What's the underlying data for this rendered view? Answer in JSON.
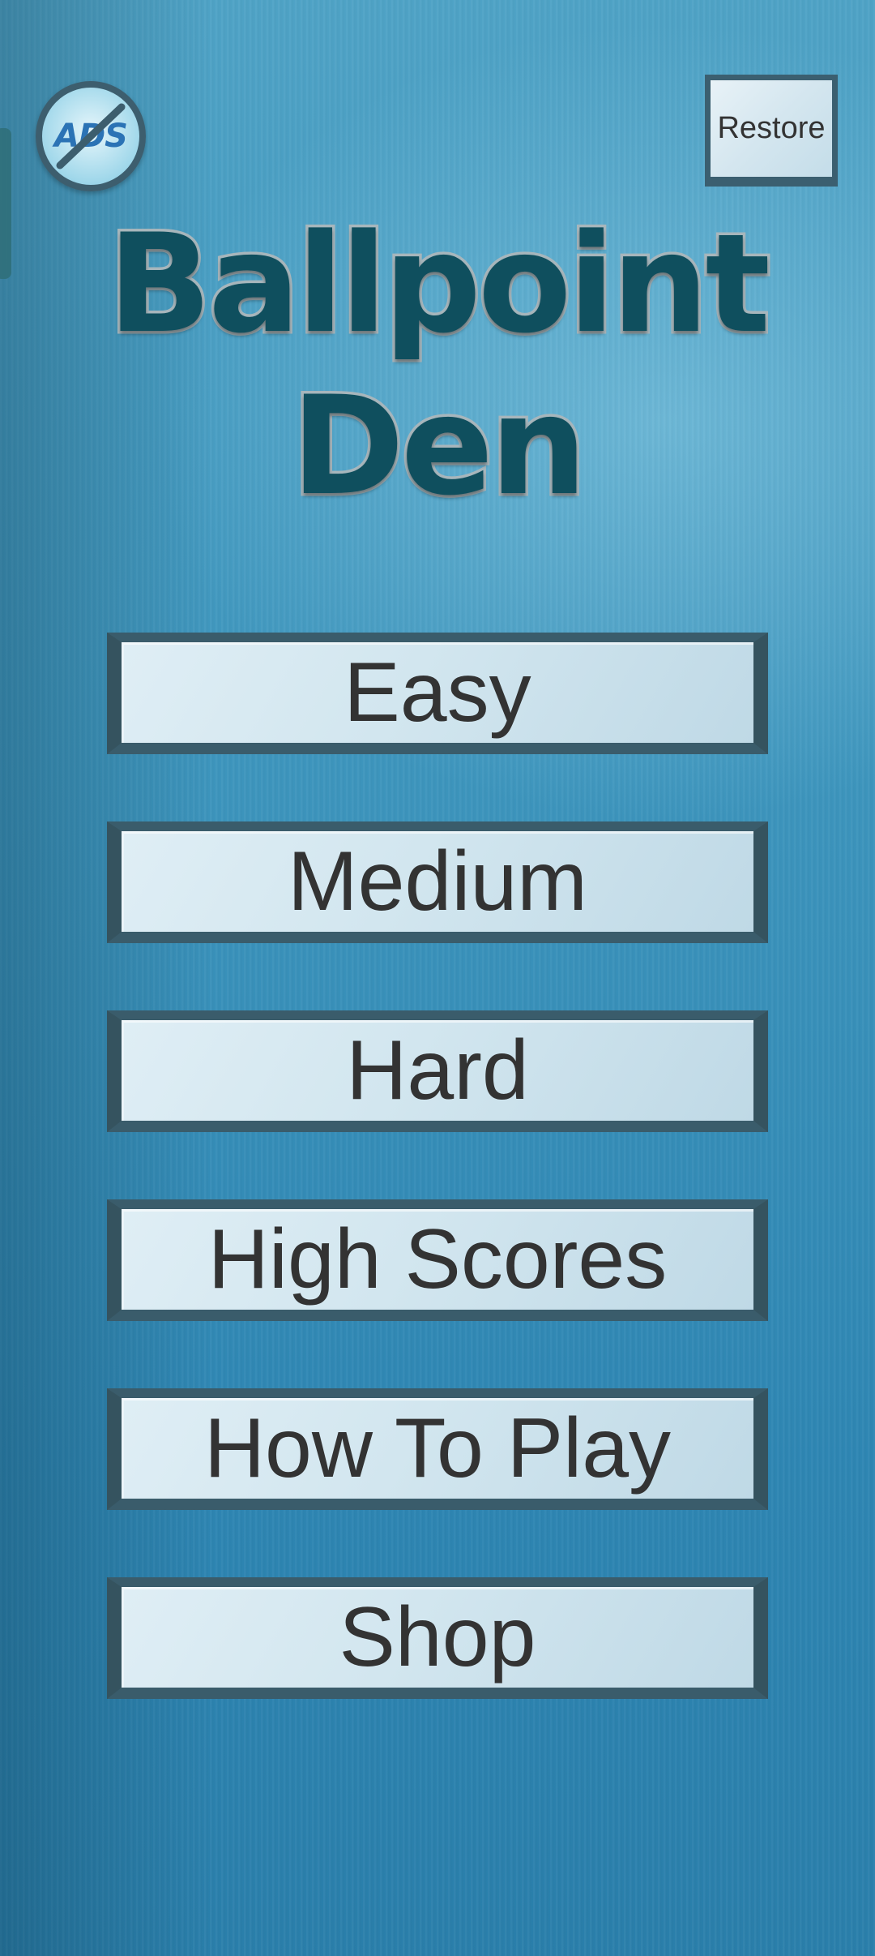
{
  "top_bar": {
    "no_ads_text": "ADS",
    "restore_label": "Restore"
  },
  "title": {
    "line1": "Ballpoint",
    "line2": "Den"
  },
  "menu": {
    "items": [
      {
        "label": "Easy"
      },
      {
        "label": "Medium"
      },
      {
        "label": "Hard"
      },
      {
        "label": "High Scores"
      },
      {
        "label": "How To Play"
      },
      {
        "label": "Shop"
      }
    ]
  },
  "colors": {
    "background": "#3d95bd",
    "title_fill": "#0f4f5e",
    "button_border": "#3a5c6b",
    "button_text": "#333333"
  },
  "icons": {
    "no_ads": "no-ads-icon"
  }
}
